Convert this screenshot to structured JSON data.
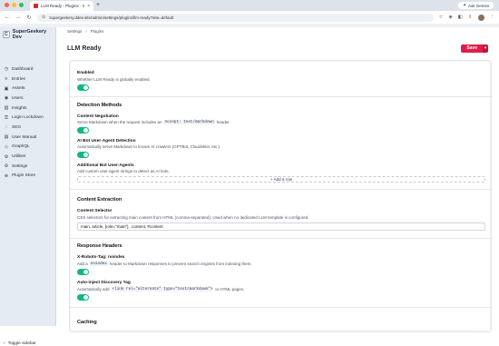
{
  "browser": {
    "tab_title": "LLM Ready - Plugins - Super Geekery Dev",
    "new_tab": "+",
    "url": "supergeekery.ddev.site/admin/settings/plugins/llm-ready?site=default",
    "ask_label": "Ask Gemini",
    "nav_back": "←",
    "nav_forward": "→",
    "nav_reload": "↻",
    "lock_icon": "⊙"
  },
  "sidebar": {
    "site_initial": "C",
    "site_name": "SuperGeekery Dev",
    "items": [
      {
        "icon": "dashboard-icon",
        "glyph": "◷",
        "label": "Dashboard"
      },
      {
        "icon": "entries-icon",
        "glyph": "≡",
        "label": "Entries"
      },
      {
        "icon": "assets-icon",
        "glyph": "▣",
        "label": "Assets"
      },
      {
        "icon": "users-icon",
        "glyph": "◉",
        "label": "Users"
      },
      {
        "icon": "insights-icon",
        "glyph": "▥",
        "label": "Insights"
      },
      {
        "icon": "login-lockdown-icon",
        "glyph": "⚿",
        "label": "Login Lockdown"
      },
      {
        "icon": "seo-icon",
        "glyph": "◌",
        "label": "SEO"
      },
      {
        "icon": "user-manual-icon",
        "glyph": "▤",
        "label": "User Manual"
      },
      {
        "icon": "graphql-icon",
        "glyph": "◇",
        "label": "GraphQL"
      },
      {
        "icon": "utilities-icon",
        "glyph": "⚙",
        "label": "Utilities"
      },
      {
        "icon": "settings-icon",
        "glyph": "⚙",
        "label": "Settings"
      },
      {
        "icon": "plugin-store-icon",
        "glyph": "⊕",
        "label": "Plugin Store"
      }
    ],
    "toggle_label": "Toggle sidebar"
  },
  "breadcrumb": {
    "items": [
      "Settings",
      "Plugins"
    ],
    "sep": "›"
  },
  "page": {
    "title": "LLM Ready",
    "save_label": "Save",
    "save_menu": "▾"
  },
  "form": {
    "enabled_label": "Enabled",
    "enabled_instructions": "Whether LLM Ready is globally enabled.",
    "detection_heading": "Detection Methods",
    "content_negotiation_label": "Content Negotiation",
    "content_negotiation_pre": "Serve Markdown when the request includes an",
    "content_negotiation_code": "Accept: text/markdown",
    "content_negotiation_post": "header.",
    "ai_bot_label": "AI Bot User-Agent Detection",
    "ai_bot_instructions": "Automatically serve Markdown to known AI crawlers (GPTBot, ClaudeBot, etc.).",
    "additional_bots_label": "Additional Bot User-Agents",
    "additional_bots_instructions": "Add custom user-agent strings to detect as AI bots.",
    "add_row_label": "+ Add a row",
    "extraction_heading": "Content Extraction",
    "content_selector_label": "Content Selector",
    "content_selector_instructions": "CSS selectors for extracting main content from HTML (comma-separated). Used when no dedicated LLM template is configured.",
    "content_selector_value": "main, article, [role=\"main\"], .content, #content",
    "response_heading": "Response Headers",
    "robots_label": "X-Robots-Tag: noindex",
    "robots_pre": "Add a",
    "robots_code": "noindex",
    "robots_post": "header to Markdown responses to prevent search engines from indexing them.",
    "auto_inject_label": "Auto-inject Discovery Tag",
    "auto_inject_pre": "Automatically add",
    "auto_inject_code": "<link rel=\"alternate\" type=\"text/markdown\">",
    "auto_inject_post": "to HTML pages.",
    "caching_heading": "Caching"
  },
  "colors": {
    "accent": "#e11d48",
    "toggle_on": "#10b981",
    "sidebar_bg": "#e4ebf3"
  }
}
